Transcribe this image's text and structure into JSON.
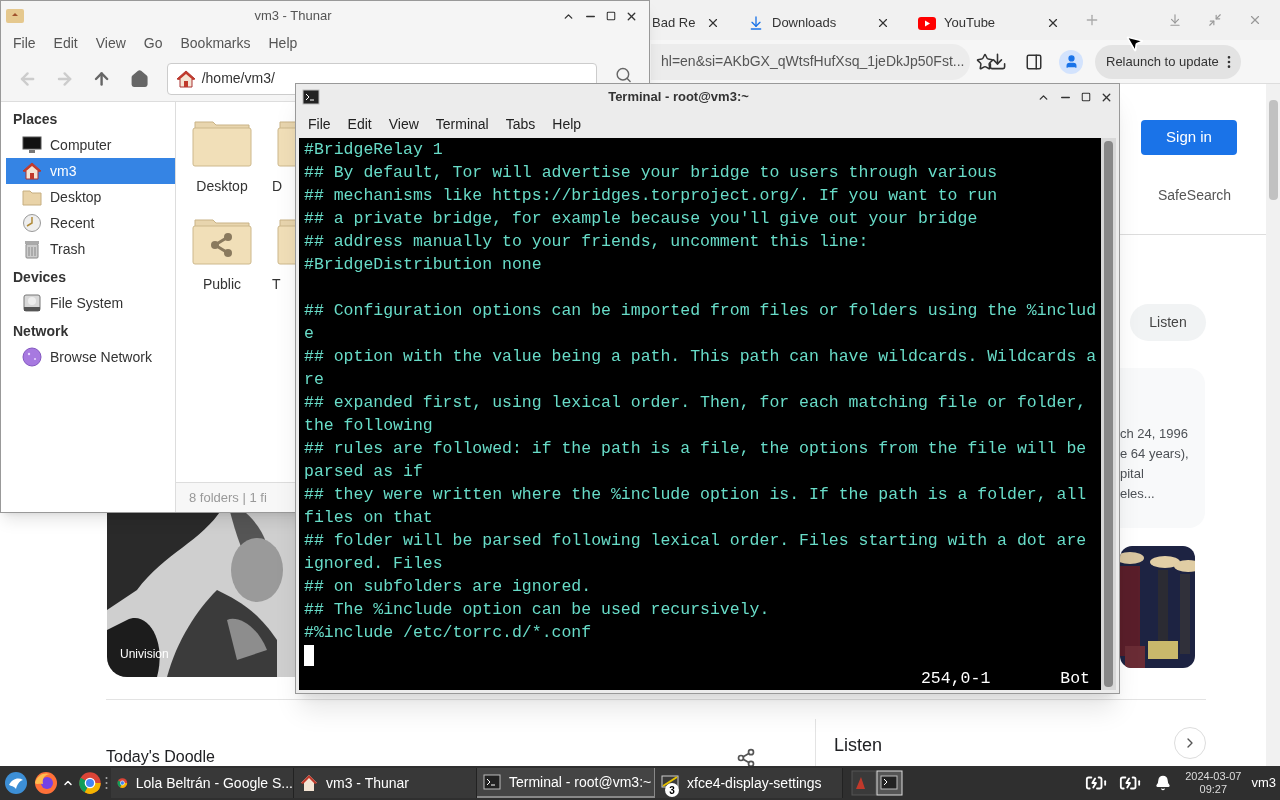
{
  "browser": {
    "tabs": [
      {
        "title": "Bad Re",
        "kind": "plain"
      },
      {
        "title": "Downloads",
        "kind": "download"
      },
      {
        "title": "YouTube",
        "kind": "youtube"
      }
    ],
    "address": "hl=en&si=AKbGX_qWtsfHufXsq_1jeDkJp50Fst...",
    "relaunch": "Relaunch to update",
    "page": {
      "sign_in": "Sign in",
      "safesearch": "SafeSearch",
      "listen_chip": "Listen",
      "card_lines": [
        "ch 24, 1996",
        "e 64 years),",
        "pital",
        "eles..."
      ],
      "picture_caption": "Univision",
      "doodle_title": "Today's Doodle",
      "listen_heading": "Listen"
    }
  },
  "thunar": {
    "title": "vm3 - Thunar",
    "menu": [
      "File",
      "Edit",
      "View",
      "Go",
      "Bookmarks",
      "Help"
    ],
    "location": "/home/vm3/",
    "sidebar": [
      {
        "title": "Places",
        "items": [
          {
            "label": "Computer",
            "kind": "computer",
            "selected": false
          },
          {
            "label": "vm3",
            "kind": "home",
            "selected": true
          },
          {
            "label": "Desktop",
            "kind": "folder",
            "selected": false
          },
          {
            "label": "Recent",
            "kind": "recent",
            "selected": false
          },
          {
            "label": "Trash",
            "kind": "trash",
            "selected": false
          }
        ]
      },
      {
        "title": "Devices",
        "items": [
          {
            "label": "File System",
            "kind": "drive",
            "selected": false
          }
        ]
      },
      {
        "title": "Network",
        "items": [
          {
            "label": "Browse Network",
            "kind": "network",
            "selected": false
          }
        ]
      }
    ],
    "folders": [
      {
        "label": "Desktop",
        "kind": "folder"
      },
      {
        "label": "D",
        "kind": "folder"
      },
      {
        "label": "Public",
        "kind": "shared"
      },
      {
        "label": "T",
        "kind": "folder"
      }
    ],
    "status": "8 folders | 1 fi"
  },
  "terminal": {
    "title": "Terminal - root@vm3:~",
    "menu": [
      "File",
      "Edit",
      "View",
      "Terminal",
      "Tabs",
      "Help"
    ],
    "rows": [
      {
        "kind": "text",
        "text": "#BridgeRelay 1"
      },
      {
        "kind": "text",
        "text": "## By default, Tor will advertise your bridge to users through various"
      },
      {
        "kind": "text",
        "text": "## mechanisms like https://bridges.torproject.org/. If you want to run"
      },
      {
        "kind": "text",
        "text": "## a private bridge, for example because you'll give out your bridge"
      },
      {
        "kind": "text",
        "text": "## address manually to your friends, uncomment this line:"
      },
      {
        "kind": "text",
        "text": "#BridgeDistribution none"
      },
      {
        "kind": "blank"
      },
      {
        "kind": "text",
        "text": "## Configuration options can be imported from files or folders using the %includ"
      },
      {
        "kind": "text",
        "text": "e"
      },
      {
        "kind": "text",
        "text": "## option with the value being a path. This path can have wildcards. Wildcards a"
      },
      {
        "kind": "text",
        "text": "re"
      },
      {
        "kind": "text",
        "text": "## expanded first, using lexical order. Then, for each matching file or folder,"
      },
      {
        "kind": "text",
        "text": "the following"
      },
      {
        "kind": "text",
        "text": "## rules are followed: if the path is a file, the options from the file will be"
      },
      {
        "kind": "text",
        "text": "parsed as if"
      },
      {
        "kind": "text",
        "text": "## they were written where the %include option is. If the path is a folder, all"
      },
      {
        "kind": "text",
        "text": "files on that"
      },
      {
        "kind": "text",
        "text": "## folder will be parsed following lexical order. Files starting with a dot are"
      },
      {
        "kind": "text",
        "text": "ignored. Files"
      },
      {
        "kind": "text",
        "text": "## on subfolders are ignored."
      },
      {
        "kind": "text",
        "text": "## The %include option can be used recursively."
      },
      {
        "kind": "text",
        "text": "#%include /etc/torrc.d/*.conf"
      },
      {
        "kind": "cursor"
      }
    ],
    "position": "254,0-1",
    "scroll": "Bot"
  },
  "taskbar": {
    "tasks": [
      {
        "title": "Lola Beltrán - Google S...",
        "kind": "chrome",
        "selected": false
      },
      {
        "title": "vm3 - Thunar",
        "kind": "thunar",
        "selected": false
      },
      {
        "title": "Terminal - root@vm3:~",
        "kind": "terminal",
        "selected": true
      },
      {
        "title": "xfce4-display-settings",
        "kind": "display",
        "badge": "3",
        "selected": false
      }
    ],
    "date": "2024-03-07",
    "time": "09:27",
    "user": "vm3"
  }
}
